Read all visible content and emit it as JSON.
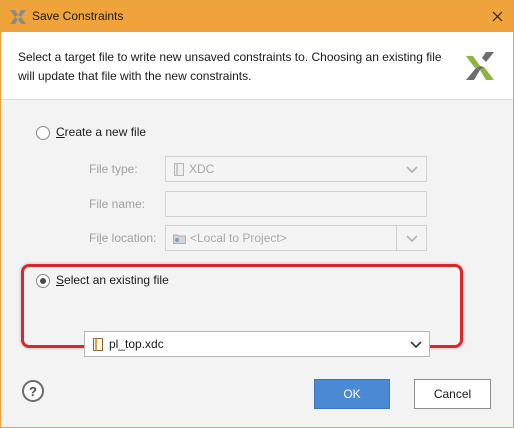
{
  "window": {
    "title": "Save Constraints",
    "accent_color": "#f0a33a",
    "title_icon": "xilinx-logo-icon",
    "close_icon": "close-icon"
  },
  "description": "Select a target file to write new unsaved constraints to. Choosing an existing file will update that file with the new constraints.",
  "brand_logo": "xilinx-logo-icon",
  "create_option": {
    "label_prefix": "",
    "label_mnemonic": "C",
    "label_rest": "reate a new file",
    "selected": false,
    "file_type": {
      "label": "File type:",
      "value": "XDC",
      "icon": "file-icon",
      "enabled": false
    },
    "file_name": {
      "label": "File name:",
      "value": "",
      "enabled": false
    },
    "file_location": {
      "label_prefix": "Fi",
      "label_mnemonic": "l",
      "label_rest": "e location:",
      "value": "<Local to Project>",
      "icon": "folder-icon",
      "enabled": false
    }
  },
  "existing_option": {
    "label_mnemonic": "S",
    "label_rest": "elect an existing file",
    "selected": true,
    "file": {
      "value": "pl_top.xdc",
      "icon": "file-icon"
    },
    "highlight_color": "#d8282a"
  },
  "footer": {
    "help_label": "?",
    "ok_label": "OK",
    "cancel_label": "Cancel",
    "ok_color": "#4a8ad4"
  }
}
